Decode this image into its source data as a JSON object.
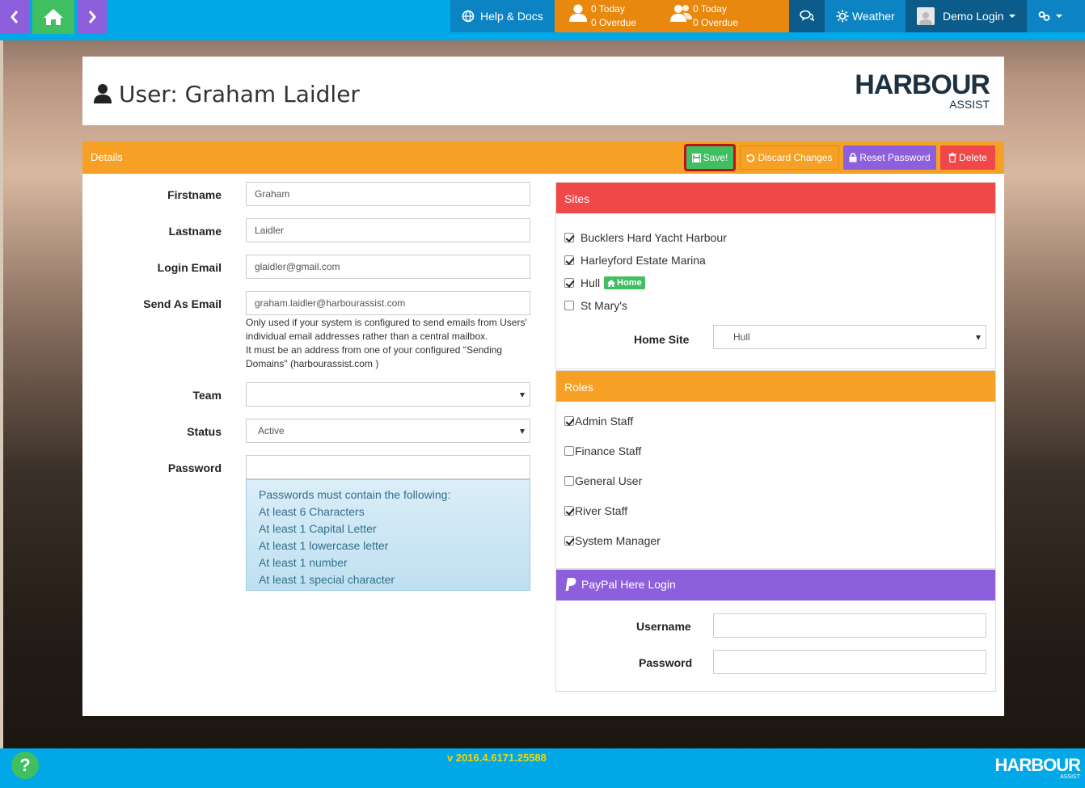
{
  "nav": {
    "help_label": "Help & Docs",
    "tasks_mine": {
      "today": "0 Today",
      "overdue": "0 Overdue"
    },
    "tasks_team": {
      "today": "0 Today",
      "overdue": "0 Overdue"
    },
    "weather_label": "Weather",
    "user_label": "Demo Login"
  },
  "header": {
    "title": "User: Graham Laidler",
    "logo_brand": "HARBOUR",
    "logo_sub": "ASSIST"
  },
  "details": {
    "title": "Details",
    "buttons": {
      "save": "Save!",
      "discard": "Discard Changes",
      "reset": "Reset Password",
      "delete": "Delete"
    },
    "fields": {
      "firstname_label": "Firstname",
      "firstname_value": "Graham",
      "lastname_label": "Lastname",
      "lastname_value": "Laidler",
      "login_email_label": "Login Email",
      "login_email_value": "glaidler@gmail.com",
      "send_email_label": "Send As Email",
      "send_email_value": "graham.laidler@harbourassist.com",
      "send_email_help_1": "Only used if your system is configured to send emails from Users' individual email addresses rather than a central mailbox.",
      "send_email_help_2": "It must be an address from one of your configured \"Sending Domains\" (harbourassist.com )",
      "team_label": "Team",
      "team_value": "",
      "status_label": "Status",
      "status_value": "Active",
      "password_label": "Password",
      "password_value": ""
    },
    "password_rules": [
      "Passwords must contain the following:",
      "At least 6 Characters",
      "At least 1 Capital Letter",
      "At least 1 lowercase letter",
      "At least 1 number",
      "At least 1 special character"
    ]
  },
  "sites": {
    "title": "Sites",
    "items": [
      {
        "label": "Bucklers Hard Yacht Harbour",
        "checked": true
      },
      {
        "label": "Harleyford Estate Marina",
        "checked": true
      },
      {
        "label": "Hull",
        "checked": true,
        "badge": "Home"
      },
      {
        "label": "St Mary's",
        "checked": false
      }
    ],
    "home_site_label": "Home Site",
    "home_site_value": "Hull"
  },
  "roles": {
    "title": "Roles",
    "items": [
      {
        "label": "Admin Staff",
        "checked": true
      },
      {
        "label": "Finance Staff",
        "checked": false
      },
      {
        "label": "General User",
        "checked": false
      },
      {
        "label": "River Staff",
        "checked": true
      },
      {
        "label": "System Manager",
        "checked": true
      }
    ]
  },
  "paypal": {
    "title": "PayPal Here Login",
    "username_label": "Username",
    "password_label": "Password"
  },
  "footer": {
    "version": "v 2016.4.6171.25588",
    "help_glyph": "?",
    "logo_brand": "HARBOUR",
    "logo_sub": "ASSIST"
  },
  "colors": {
    "nav_blue": "#00a8e8",
    "orange": "#f6a125",
    "green": "#3fbf5f",
    "purple": "#8e5fdd",
    "red": "#f04848"
  }
}
